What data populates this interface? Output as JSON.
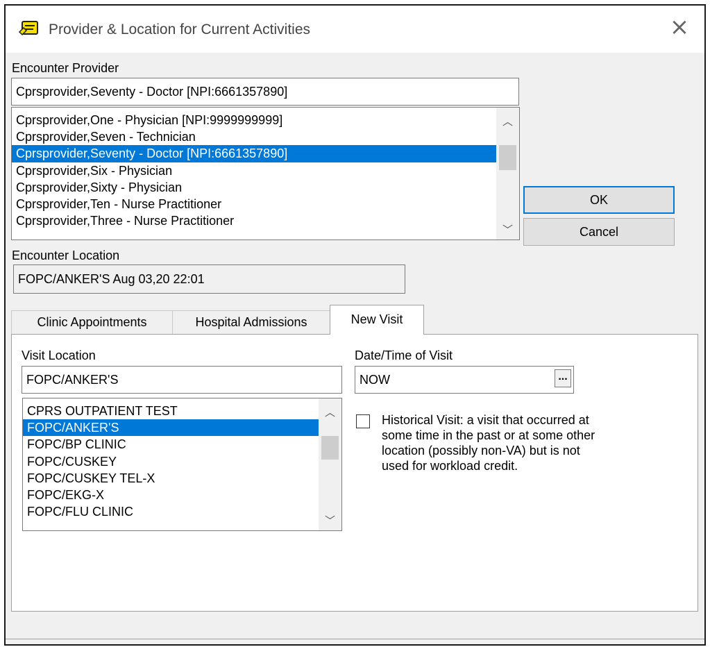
{
  "window": {
    "title": "Provider & Location for Current Activities"
  },
  "provider": {
    "label": "Encounter Provider",
    "value": "Cprsprovider,Seventy - Doctor [NPI:6661357890]",
    "items": [
      "Cprsprovider,One - Physician [NPI:9999999999]",
      "Cprsprovider,Seven - Technician",
      "Cprsprovider,Seventy - Doctor [NPI:6661357890]",
      "Cprsprovider,Six - Physician",
      "Cprsprovider,Sixty - Physician",
      "Cprsprovider,Ten - Nurse Practitioner",
      "Cprsprovider,Three - Nurse Practitioner"
    ],
    "selected_index": 2
  },
  "buttons": {
    "ok": "OK",
    "cancel": "Cancel"
  },
  "location": {
    "label": "Encounter Location",
    "value": "FOPC/ANKER'S  Aug 03,20 22:01"
  },
  "tabs": [
    {
      "label": "Clinic Appointments",
      "active": false
    },
    {
      "label": "Hospital Admissions",
      "active": false
    },
    {
      "label": "New Visit",
      "active": true
    }
  ],
  "new_visit": {
    "visit_location_label": "Visit Location",
    "visit_location_value": "FOPC/ANKER'S",
    "locations": [
      "CPRS OUTPATIENT TEST",
      "FOPC/ANKER'S",
      "FOPC/BP CLINIC",
      "FOPC/CUSKEY",
      "FOPC/CUSKEY TEL-X",
      "FOPC/EKG-X",
      "FOPC/FLU CLINIC"
    ],
    "selected_index": 1,
    "datetime_label": "Date/Time of Visit",
    "datetime_value": "NOW",
    "datetime_button": "...",
    "historical_checked": false,
    "historical_text": "Historical Visit: a visit that occurred at some time in the past or at some other location (possibly non-VA) but is not used for workload credit."
  },
  "icons": {
    "app": "notepad-icon",
    "close": "close-icon",
    "up": "scroll-up-icon",
    "down": "scroll-down-icon"
  }
}
